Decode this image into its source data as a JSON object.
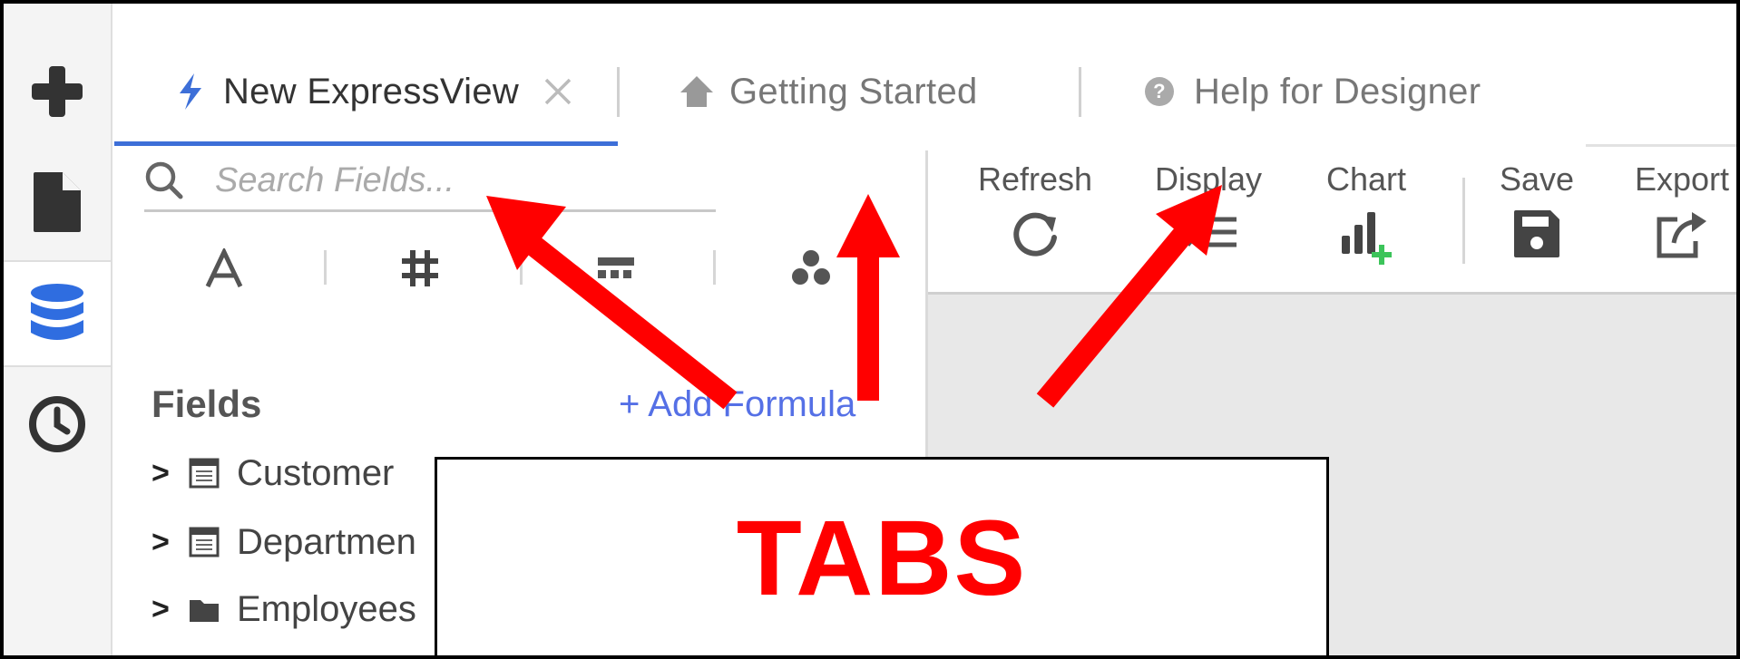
{
  "rail": {
    "items": [
      {
        "icon": "plus-icon"
      },
      {
        "icon": "document-icon"
      },
      {
        "icon": "database-icon",
        "active": true
      },
      {
        "icon": "clock-icon"
      }
    ]
  },
  "tabs": [
    {
      "label": "New ExpressView",
      "icon": "lightning-icon",
      "active": true,
      "closable": true
    },
    {
      "label": "Getting Started",
      "icon": "home-icon"
    },
    {
      "label": "Help for Designer",
      "icon": "help-circle-icon"
    }
  ],
  "search": {
    "placeholder": "Search Fields..."
  },
  "type_filters": [
    "text-type-icon",
    "number-type-icon",
    "date-type-icon",
    "group-type-icon"
  ],
  "fields_panel": {
    "title": "Fields",
    "add_formula": "+ Add Formula",
    "items": [
      {
        "label": "Customer",
        "icon": "table-icon"
      },
      {
        "label": "Departmen",
        "icon": "table-icon"
      },
      {
        "label": "Employees",
        "icon": "folder-icon"
      }
    ]
  },
  "toolbar": {
    "refresh": "Refresh",
    "display": "Display",
    "chart": "Chart",
    "save": "Save",
    "export": "Export"
  },
  "callout": {
    "text": "TABS"
  },
  "colors": {
    "accent": "#3d6fd8",
    "add_formula": "#5570e6",
    "annotation": "#ff0000",
    "chart_plus": "#3cc45a",
    "database_icon": "#2f6de0"
  }
}
